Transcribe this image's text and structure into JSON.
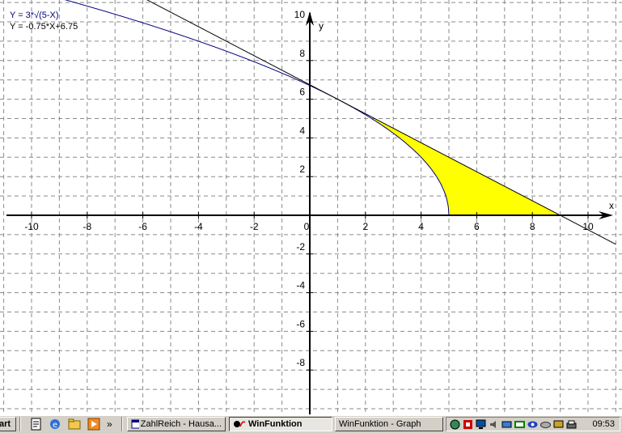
{
  "chart_data": {
    "type": "line",
    "xlim": [
      -11,
      11
    ],
    "ylim": [
      -10,
      10
    ],
    "x_ticks": [
      -10,
      -8,
      -6,
      -4,
      -2,
      0,
      2,
      4,
      6,
      8,
      10
    ],
    "y_ticks": [
      -8,
      -6,
      -4,
      -2,
      2,
      4,
      6,
      8,
      10
    ],
    "xlabel": "x",
    "ylabel": "y",
    "grid": true,
    "series": [
      {
        "name": "Y = 3*√(5-X)",
        "color": "#00007f",
        "expr": "3*sqrt(5-x)",
        "x_range": [
          -9.1,
          5
        ]
      },
      {
        "name": "Y = -0.75*X+6.75",
        "color": "#000000",
        "expr": "-0.75*x+6.75",
        "x_range": [
          -9.1,
          11
        ]
      }
    ],
    "shaded_region": {
      "color": "#ffff00",
      "between": [
        "Y = -0.75*X+6.75",
        "Y = 3*√(5-X)"
      ],
      "x_range": [
        2.33,
        9
      ]
    }
  },
  "legend": {
    "line1": "Y = 3*√(5-X)",
    "line2": "Y = -0.75*X+6.75"
  },
  "taskbar": {
    "start": "art",
    "more": "»",
    "task1": "ZahlReich - Hausa...",
    "task2": "WinFunktion",
    "task3": "WinFunktion - Graph",
    "clock": "09:53"
  }
}
